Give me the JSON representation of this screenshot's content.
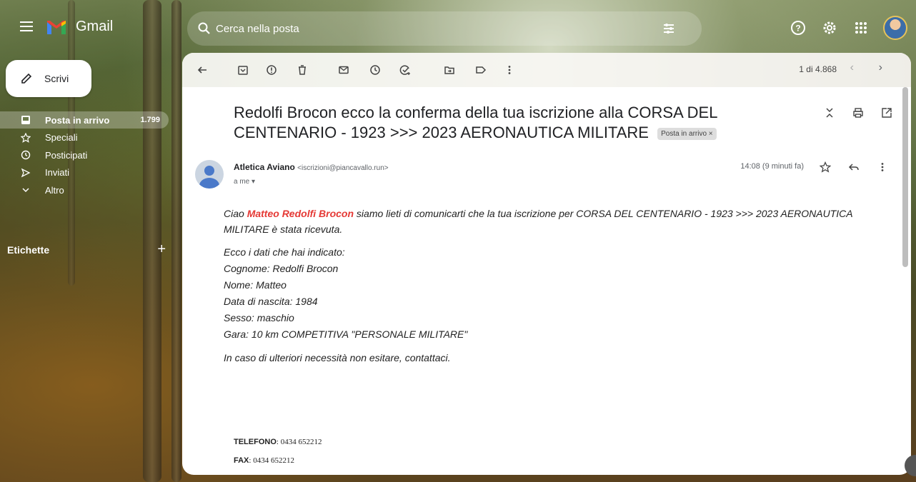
{
  "app": {
    "name": "Gmail"
  },
  "search": {
    "placeholder": "Cerca nella posta"
  },
  "compose": {
    "label": "Scrivi"
  },
  "sidebar": {
    "items": [
      {
        "label": "Posta in arrivo",
        "count": "1.799",
        "icon": "inbox-icon",
        "active": true
      },
      {
        "label": "Speciali",
        "icon": "star-icon"
      },
      {
        "label": "Posticipati",
        "icon": "clock-icon"
      },
      {
        "label": "Inviati",
        "icon": "send-icon"
      },
      {
        "label": "Altro",
        "icon": "chevron-down-icon"
      }
    ],
    "labels_heading": "Etichette",
    "labels_add": "+"
  },
  "toolbar": {
    "pager": "1 di 4.868",
    "icons": [
      "back-icon",
      "archive-icon",
      "report-spam-icon",
      "delete-icon",
      "mark-unread-icon",
      "snooze-icon",
      "add-task-icon",
      "move-to-icon",
      "label-icon",
      "more-icon"
    ]
  },
  "message": {
    "subject": "Redolfi Brocon ecco la conferma della tua iscrizione alla CORSA DEL CENTENARIO - 1923 >>> 2023 AERONAUTICA MILITARE",
    "badge": "Posta in arrivo ×",
    "sender_name": "Atletica Aviano",
    "sender_email": "<iscrizioni@piancavallo.run>",
    "to": "a me ▾",
    "time": "14:08 (9 minuti fa)",
    "greeting_prefix": "Ciao ",
    "greeting_name": "Matteo Redolfi Brocon",
    "greeting_suffix": " siamo lieti di comunicarti che la tua iscrizione per CORSA DEL CENTENARIO - 1923 >>> 2023 AERONAUTICA MILITARE è stata ricevuta.",
    "data_intro": "Ecco i dati che hai indicato:",
    "data_lines": [
      "Cognome: Redolfi Brocon",
      "Nome: Matteo",
      "Data di nascita: 1984",
      "Sesso: maschio",
      "Gara: 10 km COMPETITIVA \"PERSONALE MILITARE\""
    ],
    "closing": "In caso di ulteriori necessità non esitare, contattaci.",
    "phone_label": "TELEFONO",
    "phone": ": 0434 652212",
    "fax_label": "FAX",
    "fax": ": 0434 652212"
  },
  "colors": {
    "accent_red": "#e53935",
    "panel": "#ffffff"
  }
}
